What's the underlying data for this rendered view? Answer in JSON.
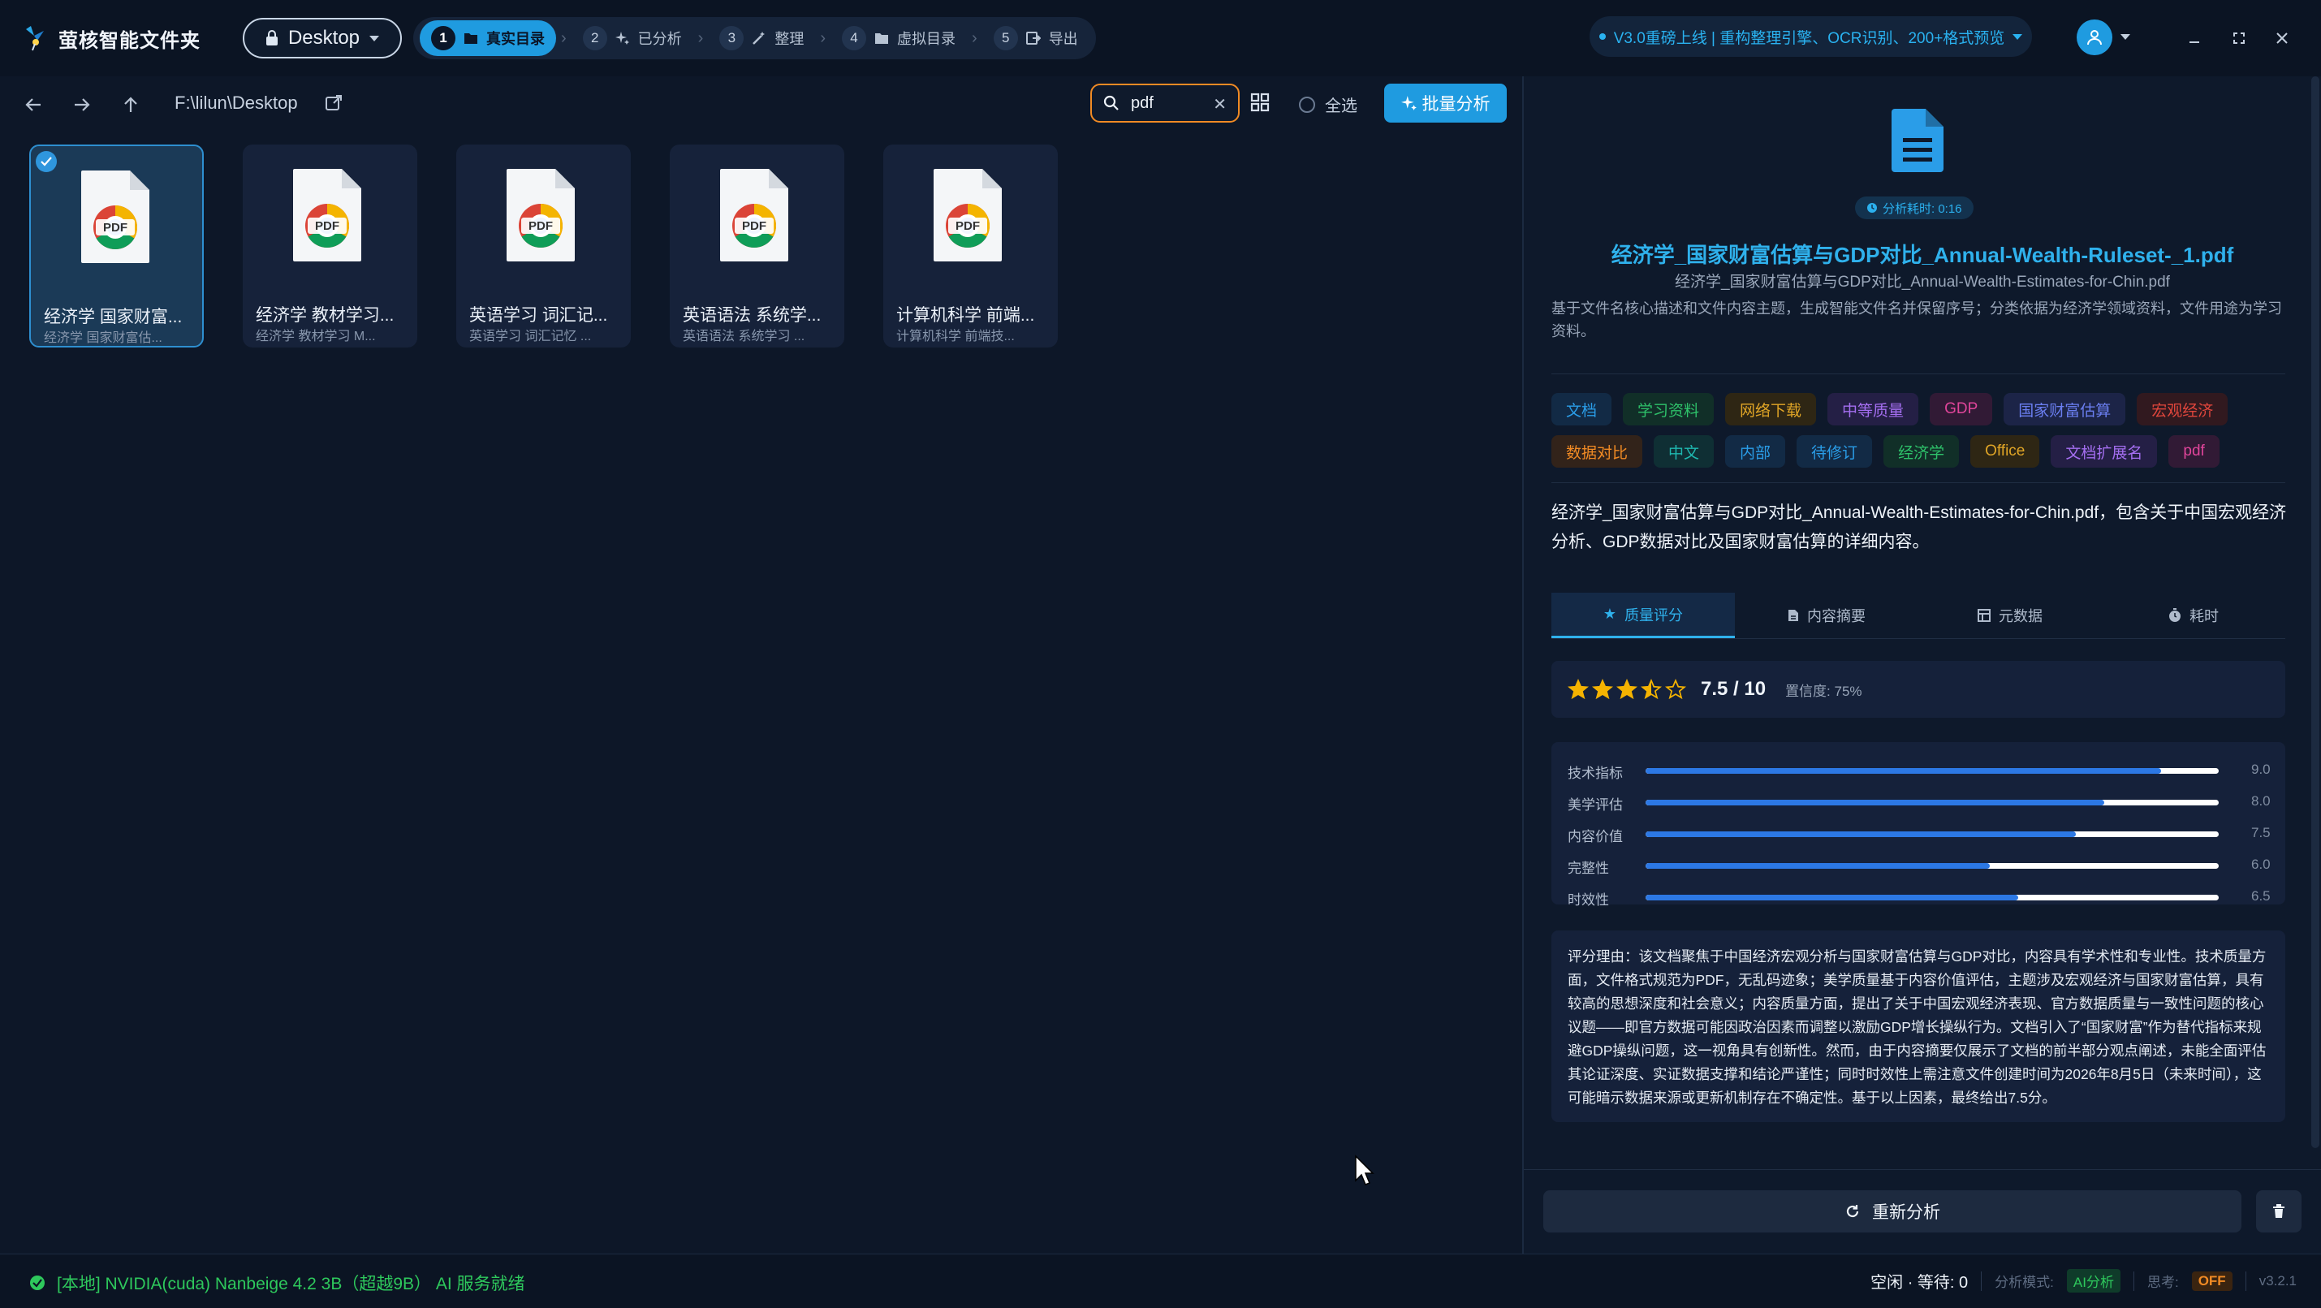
{
  "app": {
    "title": "萤核智能文件夹"
  },
  "header": {
    "dir_select": "Desktop",
    "steps": [
      {
        "num": "1",
        "label": "真实目录"
      },
      {
        "num": "2",
        "label": "已分析"
      },
      {
        "num": "3",
        "label": "整理"
      },
      {
        "num": "4",
        "label": "虚拟目录"
      },
      {
        "num": "5",
        "label": "导出"
      }
    ],
    "banner": "V3.0重磅上线 | 重构整理引擎、OCR识别、200+格式预览"
  },
  "toolbar": {
    "path": "F:\\lilun\\Desktop",
    "search_value": "pdf",
    "select_all": "全选",
    "batch_button": "批量分析"
  },
  "files": [
    {
      "name": "经济学 国家财富...",
      "sub": "经济学 国家财富估...",
      "selected": true
    },
    {
      "name": "经济学 教材学习...",
      "sub": "经济学 教材学习 M...",
      "selected": false
    },
    {
      "name": "英语学习 词汇记...",
      "sub": "英语学习 词汇记忆 ...",
      "selected": false
    },
    {
      "name": "英语语法 系统学...",
      "sub": "英语语法 系统学习 ...",
      "selected": false
    },
    {
      "name": "计算机科学 前端...",
      "sub": "计算机科学 前端技...",
      "selected": false
    }
  ],
  "detail": {
    "time_badge": "分析耗时: 0:16",
    "title": "经济学_国家财富估算与GDP对比_Annual-Wealth-Ruleset-_1.pdf",
    "original": "经济学_国家财富估算与GDP对比_Annual-Wealth-Estimates-for-Chin.pdf",
    "description": "基于文件名核心描述和文件内容主题，生成智能文件名并保留序号；分类依据为经济学领域资料，文件用途为学习资料。",
    "tags": [
      {
        "text": "文档",
        "color": "#2a9de8",
        "bg": "#122a45"
      },
      {
        "text": "学习资料",
        "color": "#2ec26a",
        "bg": "#112f28"
      },
      {
        "text": "网络下载",
        "color": "#e0a526",
        "bg": "#2e2614"
      },
      {
        "text": "中等质量",
        "color": "#a46ef0",
        "bg": "#241f45"
      },
      {
        "text": "GDP",
        "color": "#e0459a",
        "bg": "#311a35"
      },
      {
        "text": "国家财富估算",
        "color": "#6a7ef0",
        "bg": "#1c2447"
      },
      {
        "text": "宏观经济",
        "color": "#e0463c",
        "bg": "#31191f"
      },
      {
        "text": "数据对比",
        "color": "#f08a24",
        "bg": "#32231a"
      },
      {
        "text": "中文",
        "color": "#1fb8b0",
        "bg": "#0f2f34"
      },
      {
        "text": "内部",
        "color": "#2a9de8",
        "bg": "#122a45"
      },
      {
        "text": "待修订",
        "color": "#2a9de8",
        "bg": "#122a45"
      },
      {
        "text": "经济学",
        "color": "#2ec26a",
        "bg": "#112f28"
      },
      {
        "text": "Office",
        "color": "#e0a526",
        "bg": "#2e2614"
      },
      {
        "text": "文档扩展名",
        "color": "#a46ef0",
        "bg": "#241f45"
      },
      {
        "text": "pdf",
        "color": "#e0459a",
        "bg": "#311a35"
      }
    ],
    "summary": "经济学_国家财富估算与GDP对比_Annual-Wealth-Estimates-for-Chin.pdf，包含关于中国宏观经济分析、GDP数据对比及国家财富估算的详细内容。",
    "tabs": [
      {
        "label": "质量评分",
        "icon": "star-icon"
      },
      {
        "label": "内容摘要",
        "icon": "document-icon"
      },
      {
        "label": "元数据",
        "icon": "table-icon"
      },
      {
        "label": "耗时",
        "icon": "timer-icon"
      }
    ],
    "rating": {
      "stars": 3.5,
      "score": "7.5 / 10",
      "confidence": "置信度: 75%"
    },
    "metrics": [
      {
        "label": "技术指标",
        "value": "9.0",
        "fraction": 0.9
      },
      {
        "label": "美学评估",
        "value": "8.0",
        "fraction": 0.8
      },
      {
        "label": "内容价值",
        "value": "7.5",
        "fraction": 0.75
      },
      {
        "label": "完整性",
        "value": "6.0",
        "fraction": 0.6
      },
      {
        "label": "时效性",
        "value": "6.5",
        "fraction": 0.65
      }
    ],
    "reason": "评分理由：该文档聚焦于中国经济宏观分析与国家财富估算与GDP对比，内容具有学术性和专业性。技术质量方面，文件格式规范为PDF，无乱码迹象；美学质量基于内容价值评估，主题涉及宏观经济与国家财富估算，具有较高的思想深度和社会意义；内容质量方面，提出了关于中国宏观经济表现、官方数据质量与一致性问题的核心议题——即官方数据可能因政治因素而调整以激励GDP增长操纵行为。文档引入了“国家财富”作为替代指标来规避GDP操纵问题，这一视角具有创新性。然而，由于内容摘要仅展示了文档的前半部分观点阐述，未能全面评估其论证深度、实证数据支撑和结论严谨性；同时时效性上需注意文件创建时间为2026年8月5日（未来时间），这可能暗示数据来源或更新机制存在不确定性。基于以上因素，最终给出7.5分。",
    "reanalyze": "重新分析"
  },
  "status": {
    "left": "[本地] NVIDIA(cuda) Nanbeige 4.2 3B（超越9B） AI 服务就绪",
    "queue": "空闲 · 等待: 0",
    "mode_label": "分析模式:",
    "mode_value": "AI分析",
    "think_label": "思考:",
    "think_value": "OFF",
    "version": "v3.2.1"
  }
}
